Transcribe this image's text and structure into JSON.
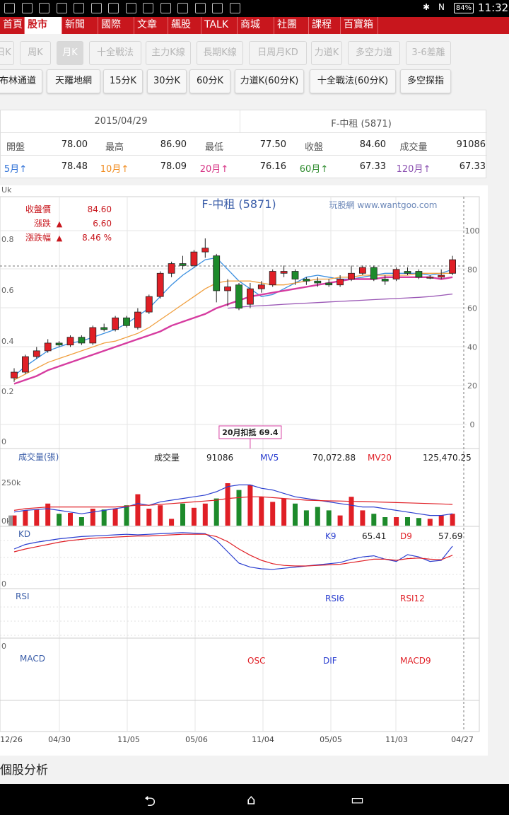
{
  "status_bar": {
    "icons": [
      "settings-icon",
      "signal-icon",
      "mail-icon",
      "calendar-icon",
      "app-icon",
      "photo-icon",
      "news-icon",
      "gallery-icon",
      "avatar-icon",
      "upload-icon",
      "image-icon",
      "check-icon",
      "download-icon",
      "dollar-icon"
    ],
    "battery": "84%",
    "time": "11:32"
  },
  "nav": {
    "items": [
      "首頁",
      "股市",
      "新聞",
      "國際",
      "文章",
      "飆股",
      "TALK",
      "商城",
      "社團",
      "課程",
      "百寶箱"
    ],
    "active": "股市"
  },
  "toolbar": {
    "row1": [
      "日K",
      "周K",
      "月K",
      "十全戰法",
      "主力K線",
      "長期K線",
      "日周月KD",
      "力道K",
      "多空力道",
      "3-6差離"
    ],
    "row2": [
      "布林通道",
      "天羅地網",
      "15分K",
      "30分K",
      "60分K",
      "力道K(60分K)",
      "十全戰法(60分K)",
      "多空探指"
    ],
    "selected": "月K"
  },
  "info": {
    "date": "2015/04/29",
    "stock": "F-中租 (5871)",
    "quote": [
      {
        "label": "開盤",
        "value": "78.00"
      },
      {
        "label": "最高",
        "value": "86.90"
      },
      {
        "label": "最低",
        "value": "77.50"
      },
      {
        "label": "收盤",
        "value": "84.60"
      },
      {
        "label": "成交量",
        "value": "91086"
      }
    ],
    "ma": [
      {
        "label": "5月",
        "arrow": "↑",
        "value": "78.48",
        "color": "#2c6fd6"
      },
      {
        "label": "10月",
        "arrow": "↑",
        "value": "78.09",
        "color": "#f08a1c"
      },
      {
        "label": "20月",
        "arrow": "↑",
        "value": "76.16",
        "color": "#d63384"
      },
      {
        "label": "60月",
        "arrow": "↑",
        "value": "67.33",
        "color": "#2e8b2e"
      },
      {
        "label": "120月",
        "arrow": "↑",
        "value": "67.33",
        "color": "#8a4fb0"
      }
    ]
  },
  "chart_data": {
    "type": "candlestick",
    "title": "F-中租 (5871)",
    "watermark": "玩股網 www.wantgoo.com",
    "summary": [
      {
        "label": "收盤價",
        "marker": "",
        "value": "84.60"
      },
      {
        "label": "漲跌",
        "marker": "▲",
        "value": "6.60"
      },
      {
        "label": "漲跌幅",
        "marker": "▲",
        "value": "8.46 %"
      }
    ],
    "right_axis": {
      "ticks": [
        0,
        20,
        40,
        60,
        80,
        100
      ],
      "range": [
        0,
        100
      ]
    },
    "left_axis_ticks": [
      "0",
      "0.2",
      "0.4",
      "0.6",
      "0.8",
      "Uk"
    ],
    "x_labels": [
      "12/26",
      "04/30",
      "11/05",
      "05/06",
      "11/04",
      "05/05",
      "11/03",
      "04/27"
    ],
    "annotation": "20月扣抵 69.4",
    "candles": [
      {
        "o": 24,
        "c": 27,
        "h": 29,
        "l": 22
      },
      {
        "o": 27,
        "c": 35,
        "h": 36,
        "l": 26
      },
      {
        "o": 35,
        "c": 38,
        "h": 40,
        "l": 34
      },
      {
        "o": 38,
        "c": 42,
        "h": 44,
        "l": 37
      },
      {
        "o": 42,
        "c": 41,
        "h": 43,
        "l": 40
      },
      {
        "o": 41,
        "c": 45,
        "h": 46,
        "l": 40
      },
      {
        "o": 45,
        "c": 42,
        "h": 46,
        "l": 41
      },
      {
        "o": 42,
        "c": 50,
        "h": 51,
        "l": 41
      },
      {
        "o": 50,
        "c": 49,
        "h": 52,
        "l": 48
      },
      {
        "o": 49,
        "c": 55,
        "h": 56,
        "l": 48
      },
      {
        "o": 55,
        "c": 51,
        "h": 56,
        "l": 50
      },
      {
        "o": 50,
        "c": 58,
        "h": 60,
        "l": 49
      },
      {
        "o": 58,
        "c": 66,
        "h": 67,
        "l": 57
      },
      {
        "o": 66,
        "c": 78,
        "h": 79,
        "l": 65
      },
      {
        "o": 78,
        "c": 83,
        "h": 84,
        "l": 76
      },
      {
        "o": 83,
        "c": 82,
        "h": 87,
        "l": 80
      },
      {
        "o": 82,
        "c": 89,
        "h": 90,
        "l": 81
      },
      {
        "o": 89,
        "c": 91,
        "h": 96,
        "l": 86
      },
      {
        "o": 87,
        "c": 69,
        "h": 88,
        "l": 63
      },
      {
        "o": 69,
        "c": 71,
        "h": 75,
        "l": 61
      },
      {
        "o": 72,
        "c": 60,
        "h": 73,
        "l": 59
      },
      {
        "o": 62,
        "c": 70,
        "h": 73,
        "l": 60
      },
      {
        "o": 70,
        "c": 72,
        "h": 74,
        "l": 68
      },
      {
        "o": 72,
        "c": 79,
        "h": 80,
        "l": 71
      },
      {
        "o": 78,
        "c": 79,
        "h": 82,
        "l": 76
      },
      {
        "o": 79,
        "c": 75,
        "h": 80,
        "l": 72
      },
      {
        "o": 75,
        "c": 74,
        "h": 76,
        "l": 72
      },
      {
        "o": 74,
        "c": 73,
        "h": 76,
        "l": 71
      },
      {
        "o": 73,
        "c": 72,
        "h": 75,
        "l": 71
      },
      {
        "o": 72,
        "c": 75,
        "h": 77,
        "l": 71
      },
      {
        "o": 75,
        "c": 78,
        "h": 82,
        "l": 74
      },
      {
        "o": 78,
        "c": 81,
        "h": 82,
        "l": 77
      },
      {
        "o": 81,
        "c": 75,
        "h": 82,
        "l": 74
      },
      {
        "o": 75,
        "c": 74,
        "h": 77,
        "l": 72
      },
      {
        "o": 75,
        "c": 80,
        "h": 81,
        "l": 74
      },
      {
        "o": 79,
        "c": 78,
        "h": 81,
        "l": 77
      },
      {
        "o": 79,
        "c": 76,
        "h": 80,
        "l": 75
      },
      {
        "o": 76,
        "c": 76,
        "h": 77,
        "l": 75
      },
      {
        "o": 76,
        "c": 77,
        "h": 80,
        "l": 75
      },
      {
        "o": 78,
        "c": 85,
        "h": 87,
        "l": 77
      }
    ],
    "ma_lines": [
      {
        "name": "MA5",
        "color": "#3b8fe0",
        "values": [
          25,
          30,
          34,
          38,
          40,
          42,
          43,
          45,
          47,
          49,
          52,
          56,
          60,
          66,
          72,
          77,
          81,
          85,
          86,
          80,
          74,
          70,
          66,
          67,
          70,
          73,
          76,
          77,
          76,
          75,
          75,
          76,
          77,
          78,
          78,
          78,
          78,
          77,
          78,
          80
        ]
      },
      {
        "name": "MA10",
        "color": "#f0a040",
        "values": [
          23,
          26,
          29,
          32,
          34,
          36,
          38,
          40,
          42,
          43,
          45,
          47,
          50,
          54,
          58,
          62,
          66,
          70,
          73,
          74,
          74,
          74,
          73,
          72,
          72,
          73,
          74,
          75,
          75,
          76,
          76,
          77,
          77,
          77,
          77,
          77,
          78,
          78,
          78,
          78
        ]
      },
      {
        "name": "MA20",
        "color": "#d63ca0",
        "values": [
          21,
          23,
          25,
          28,
          30,
          32,
          34,
          36,
          38,
          40,
          42,
          44,
          46,
          48,
          51,
          53,
          55,
          57,
          60,
          62,
          64,
          66,
          67,
          68,
          69,
          70,
          71,
          72,
          73,
          74,
          75,
          75,
          75,
          76,
          76,
          76,
          76,
          76,
          75,
          76
        ]
      },
      {
        "name": "MA60",
        "color": "#9b59b6",
        "values": [
          null,
          null,
          null,
          null,
          null,
          null,
          null,
          null,
          null,
          null,
          null,
          null,
          null,
          null,
          null,
          null,
          null,
          null,
          null,
          60,
          60.5,
          61,
          61.3,
          61.6,
          62,
          62.3,
          62.6,
          62.9,
          63.2,
          63.5,
          63.8,
          64.1,
          64.4,
          64.7,
          65,
          65.3,
          65.6,
          66,
          66.6,
          67.3
        ]
      }
    ],
    "volume": {
      "label": "成交量(張)",
      "current_label": "成交量",
      "current": "91086",
      "mv5_label": "MV5",
      "mv5": "70,072.88",
      "mv20_label": "MV20",
      "mv20": "125,470.25",
      "y_ticks": [
        "250k",
        "0k"
      ],
      "bars": [
        60,
        90,
        95,
        130,
        70,
        75,
        50,
        100,
        95,
        100,
        120,
        185,
        100,
        120,
        40,
        130,
        105,
        130,
        160,
        250,
        210,
        240,
        170,
        140,
        160,
        130,
        90,
        110,
        90,
        60,
        170,
        90,
        70,
        50,
        50,
        50,
        45,
        40,
        60,
        70
      ],
      "mv5_line": [
        80,
        90,
        95,
        100,
        90,
        80,
        70,
        80,
        90,
        100,
        110,
        130,
        120,
        140,
        150,
        160,
        170,
        180,
        200,
        230,
        240,
        240,
        220,
        210,
        190,
        170,
        160,
        150,
        140,
        130,
        120,
        110,
        110,
        100,
        90,
        80,
        70,
        60,
        60,
        70
      ],
      "mv20_line": [
        90,
        100,
        105,
        110,
        110,
        110,
        110,
        110,
        110,
        110,
        115,
        120,
        120,
        125,
        130,
        135,
        140,
        145,
        150,
        160,
        165,
        170,
        170,
        165,
        160,
        155,
        150,
        148,
        146,
        145,
        143,
        142,
        140,
        138,
        136,
        134,
        132,
        130,
        128,
        125
      ]
    },
    "kd": {
      "label": "KD",
      "k_label": "K9",
      "k_value": "65.41",
      "d_label": "D9",
      "d_value": "57.69",
      "k_line": [
        60,
        68,
        72,
        75,
        78,
        80,
        82,
        83,
        84,
        85,
        86,
        85,
        86,
        87,
        88,
        89,
        88,
        87,
        75,
        55,
        35,
        28,
        25,
        24,
        26,
        28,
        30,
        32,
        34,
        36,
        42,
        46,
        48,
        42,
        38,
        50,
        46,
        38,
        40,
        65
      ],
      "d_line": [
        55,
        60,
        64,
        68,
        72,
        75,
        77,
        79,
        80,
        81,
        82,
        83,
        83,
        84,
        85,
        86,
        86,
        86,
        82,
        73,
        60,
        49,
        40,
        34,
        31,
        30,
        30,
        31,
        32,
        33,
        36,
        39,
        42,
        42,
        40,
        43,
        44,
        42,
        41,
        49
      ]
    },
    "rsi": {
      "label": "RSI",
      "rsi6_label": "RSI6",
      "rsi12_label": "RSI12"
    },
    "macd": {
      "label": "MACD",
      "osc_label": "OSC",
      "dif_label": "DIF",
      "macd9_label": "MACD9"
    }
  },
  "footer": {
    "section_title": "個股分析"
  },
  "bottom_nav": {
    "back": "back-icon",
    "home": "home-icon",
    "recent": "recent-apps-icon"
  }
}
